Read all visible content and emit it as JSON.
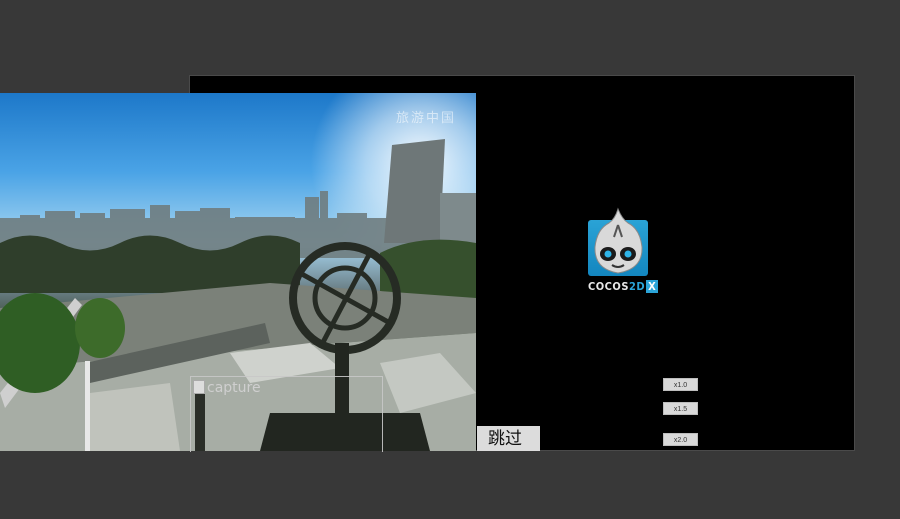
{
  "video": {
    "watermark": "旅游中国"
  },
  "capture": {
    "alt_text": "capture"
  },
  "logo": {
    "brand": "COCOS",
    "version": "2D",
    "suffix": "X"
  },
  "speed_buttons": [
    "x1.0",
    "x1.5",
    "x2.0"
  ],
  "skip_button": {
    "label": "跳过"
  }
}
